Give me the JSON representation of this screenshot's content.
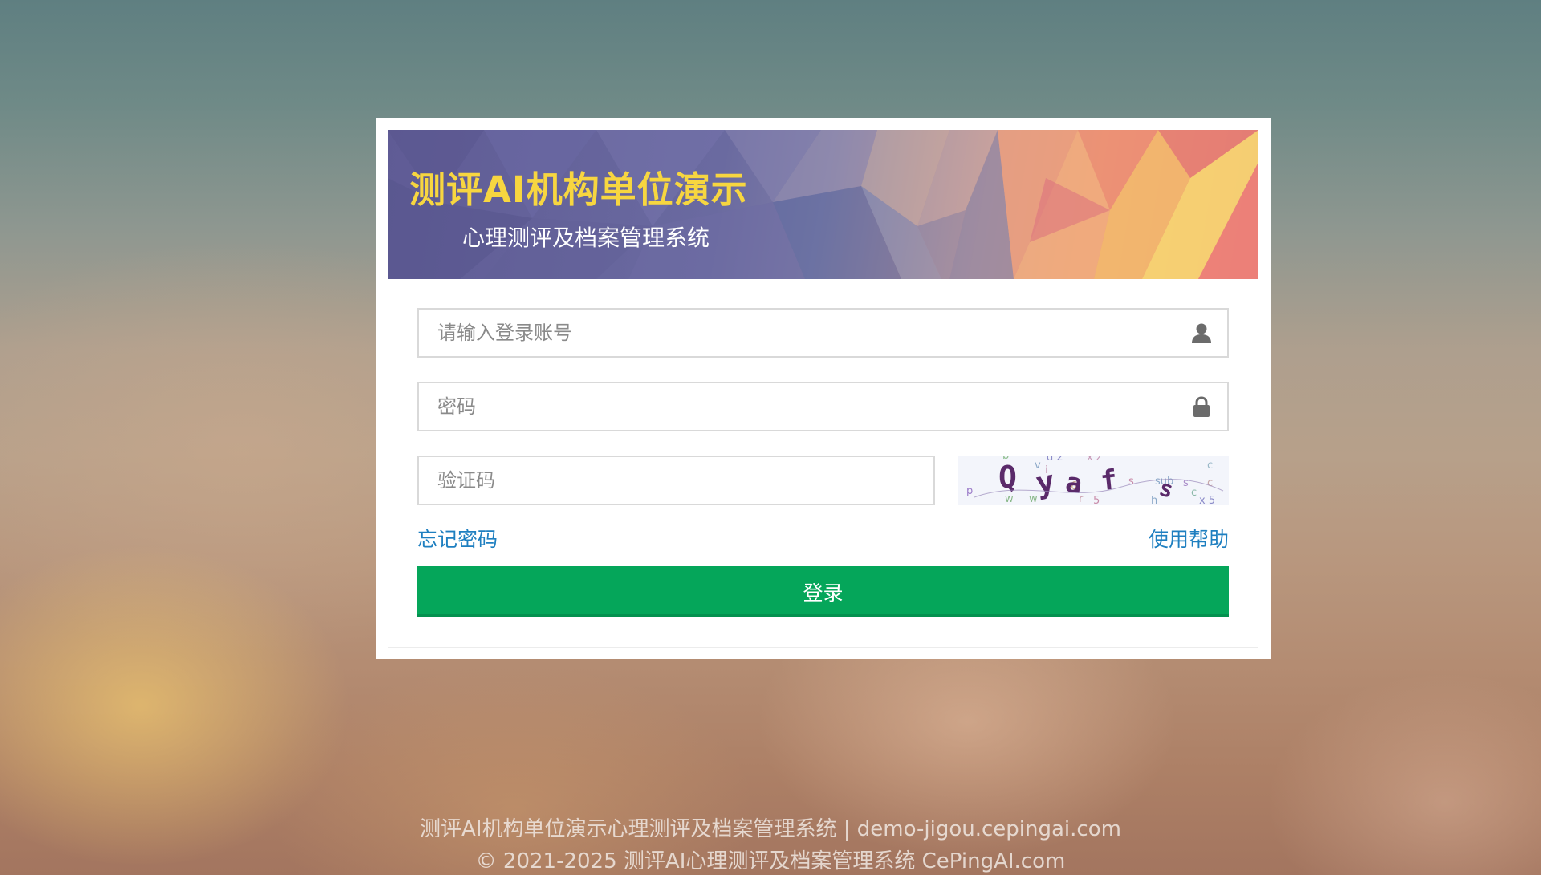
{
  "banner": {
    "title": "测评AI机构单位演示",
    "subtitle": "心理测评及档案管理系统"
  },
  "login_form": {
    "username": {
      "placeholder": "请输入登录账号",
      "value": "",
      "icon": "user-icon"
    },
    "password": {
      "placeholder": "密码",
      "value": "",
      "icon": "lock-icon"
    },
    "captcha_input": {
      "placeholder": "验证码",
      "value": ""
    },
    "captcha_image": {
      "text": "Qyafs"
    },
    "forgot_password_label": "忘记密码",
    "help_label": "使用帮助",
    "submit_label": "登录"
  },
  "footer": {
    "line1": "测评AI机构单位演示心理测评及档案管理系统 | demo-jigou.cepingai.com",
    "line2": "© 2021-2025 测评AI心理测评及档案管理系统 CePingAI.com"
  },
  "colors": {
    "title_yellow": "#f7d640",
    "link_blue": "#1e7fc0",
    "button_green": "#05a65a"
  }
}
